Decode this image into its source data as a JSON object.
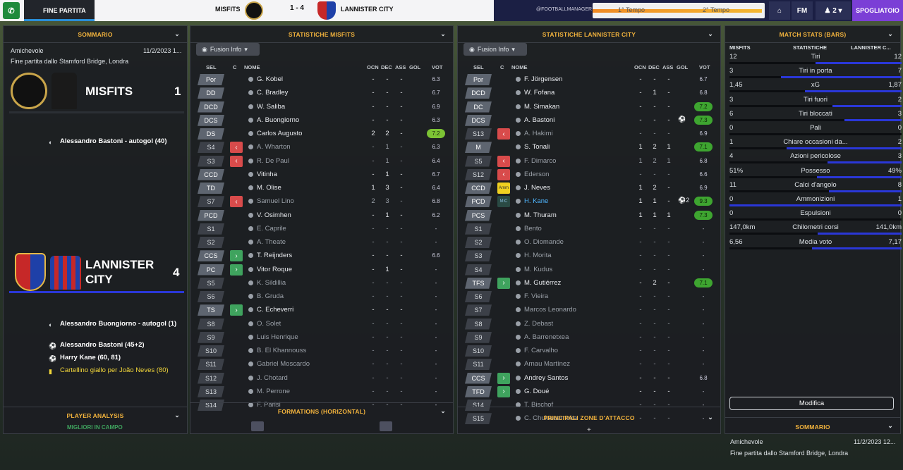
{
  "topbar": {
    "fine_partita": "FINE PARTITA",
    "home_team": "MISFITS",
    "score": "1 - 4",
    "away_team": "LANNISTER CITY",
    "time_first": "1° Tempo",
    "time_second": "2° Tempo",
    "fm_label": "FM",
    "users": "2",
    "spogliatoio": "SPOGLIATOIO",
    "sponsor": "@FOOTBALLMANAGER"
  },
  "summary": {
    "title": "SOMMARIO",
    "competition": "Amichevole",
    "date": "11/2/2023 1...",
    "end_text": "Fine partita dallo Stamford Bridge, Londra",
    "home_name": "MISFITS",
    "home_score": "1",
    "home_events": [
      {
        "icon": "own-goal",
        "text": "Alessandro Bastoni - autogol (40)"
      }
    ],
    "away_name": "LANNISTER CITY",
    "away_score": "4",
    "away_events": [
      {
        "icon": "own-goal",
        "text": "Alessandro Buongiorno - autogol (1)"
      },
      {
        "icon": "goal",
        "text": "Alessandro Bastoni (45+2)"
      },
      {
        "icon": "goal",
        "text": "Harry Kane (60, 81)"
      },
      {
        "icon": "yellow-card",
        "text": "Cartellino giallo per João Neves (80)"
      }
    ],
    "player_analysis": "PLAYER ANALYSIS",
    "migliori": "MIGLIORI IN CAMPO"
  },
  "misfits_stats": {
    "title": "STATISTICHE MISFITS",
    "fusion": "Fusion Info",
    "headers": {
      "sel": "SEL",
      "c": "C",
      "nome": "NOME",
      "ocn": "OCN",
      "dec": "DEC",
      "ass": "ASS",
      "gol": "GOL",
      "vot": "VOT"
    },
    "rows": [
      {
        "pos": "Por",
        "ind": "",
        "name": "G. Kobel",
        "ocn": "-",
        "dec": "-",
        "ass": "-",
        "gol": "",
        "vot": "6.3",
        "vc": "",
        "dim": false
      },
      {
        "pos": "DD",
        "ind": "",
        "name": "C. Bradley",
        "ocn": "-",
        "dec": "-",
        "ass": "-",
        "gol": "",
        "vot": "6.7",
        "vc": "",
        "dim": false
      },
      {
        "pos": "DCD",
        "ind": "",
        "name": "W. Saliba",
        "ocn": "-",
        "dec": "-",
        "ass": "-",
        "gol": "",
        "vot": "6.9",
        "vc": "",
        "dim": false
      },
      {
        "pos": "DCS",
        "ind": "",
        "name": "A. Buongiorno",
        "ocn": "-",
        "dec": "-",
        "ass": "-",
        "gol": "",
        "vot": "6.3",
        "vc": "",
        "dim": false
      },
      {
        "pos": "DS",
        "ind": "",
        "name": "Carlos Augusto",
        "ocn": "2",
        "dec": "2",
        "ass": "-",
        "gol": "",
        "vot": "7.2",
        "vc": "g",
        "dim": false
      },
      {
        "pos": "S4",
        "ind": "out",
        "name": "A. Wharton",
        "ocn": "-",
        "dec": "1",
        "ass": "-",
        "gol": "",
        "vot": "6.3",
        "vc": "",
        "dim": true
      },
      {
        "pos": "S3",
        "ind": "out",
        "name": "R. De Paul",
        "ocn": "-",
        "dec": "1",
        "ass": "-",
        "gol": "",
        "vot": "6.4",
        "vc": "",
        "dim": true
      },
      {
        "pos": "CCD",
        "ind": "",
        "name": "Vitinha",
        "ocn": "-",
        "dec": "1",
        "ass": "-",
        "gol": "",
        "vot": "6.7",
        "vc": "",
        "dim": false
      },
      {
        "pos": "TD",
        "ind": "",
        "name": "M. Olise",
        "ocn": "1",
        "dec": "3",
        "ass": "-",
        "gol": "",
        "vot": "6.4",
        "vc": "",
        "dim": false
      },
      {
        "pos": "S7",
        "ind": "out",
        "name": "Samuel Lino",
        "ocn": "2",
        "dec": "3",
        "ass": "-",
        "gol": "",
        "vot": "6.8",
        "vc": "",
        "dim": true
      },
      {
        "pos": "PCD",
        "ind": "",
        "name": "V. Osimhen",
        "ocn": "-",
        "dec": "1",
        "ass": "-",
        "gol": "",
        "vot": "6.2",
        "vc": "",
        "dim": false
      },
      {
        "pos": "S1",
        "ind": "",
        "name": "E. Caprile",
        "ocn": "-",
        "dec": "-",
        "ass": "-",
        "gol": "",
        "vot": "-",
        "vc": "",
        "dim": true
      },
      {
        "pos": "S2",
        "ind": "",
        "name": "A. Theate",
        "ocn": "-",
        "dec": "-",
        "ass": "-",
        "gol": "",
        "vot": "-",
        "vc": "",
        "dim": true
      },
      {
        "pos": "CCS",
        "ind": "in",
        "name": "T. Reijnders",
        "ocn": "-",
        "dec": "-",
        "ass": "-",
        "gol": "",
        "vot": "6.6",
        "vc": "",
        "dim": false
      },
      {
        "pos": "PC",
        "ind": "in",
        "name": "Vitor Roque",
        "ocn": "-",
        "dec": "1",
        "ass": "-",
        "gol": "",
        "vot": "-",
        "vc": "",
        "dim": false
      },
      {
        "pos": "S5",
        "ind": "",
        "name": "K. Sildillia",
        "ocn": "-",
        "dec": "-",
        "ass": "-",
        "gol": "",
        "vot": "-",
        "vc": "",
        "dim": true
      },
      {
        "pos": "S6",
        "ind": "",
        "name": "B. Gruda",
        "ocn": "-",
        "dec": "-",
        "ass": "-",
        "gol": "",
        "vot": "-",
        "vc": "",
        "dim": true
      },
      {
        "pos": "TS",
        "ind": "in",
        "name": "C. Echeverri",
        "ocn": "-",
        "dec": "-",
        "ass": "-",
        "gol": "",
        "vot": "-",
        "vc": "",
        "dim": false
      },
      {
        "pos": "S8",
        "ind": "",
        "name": "O. Solet",
        "ocn": "-",
        "dec": "-",
        "ass": "-",
        "gol": "",
        "vot": "-",
        "vc": "",
        "dim": true
      },
      {
        "pos": "S9",
        "ind": "",
        "name": "Luis Henrique",
        "ocn": "-",
        "dec": "-",
        "ass": "-",
        "gol": "",
        "vot": "-",
        "vc": "",
        "dim": true
      },
      {
        "pos": "S10",
        "ind": "",
        "name": "B. El Khannouss",
        "ocn": "-",
        "dec": "-",
        "ass": "-",
        "gol": "",
        "vot": "-",
        "vc": "",
        "dim": true
      },
      {
        "pos": "S11",
        "ind": "",
        "name": "Gabriel Moscardo",
        "ocn": "-",
        "dec": "-",
        "ass": "-",
        "gol": "",
        "vot": "-",
        "vc": "",
        "dim": true
      },
      {
        "pos": "S12",
        "ind": "",
        "name": "J. Chotard",
        "ocn": "-",
        "dec": "-",
        "ass": "-",
        "gol": "",
        "vot": "-",
        "vc": "",
        "dim": true
      },
      {
        "pos": "S13",
        "ind": "",
        "name": "M. Perrone",
        "ocn": "-",
        "dec": "-",
        "ass": "-",
        "gol": "",
        "vot": "-",
        "vc": "",
        "dim": true
      },
      {
        "pos": "S14",
        "ind": "",
        "name": "F. Parisi",
        "ocn": "-",
        "dec": "-",
        "ass": "-",
        "gol": "",
        "vot": "-",
        "vc": "",
        "dim": true
      }
    ],
    "formations": "FORMATIONS (HORIZONTAL)"
  },
  "lannister_stats": {
    "title": "STATISTICHE LANNISTER CITY",
    "fusion": "Fusion Info",
    "headers": {
      "sel": "SEL",
      "c": "C",
      "nome": "NOME",
      "ocn": "OCN",
      "dec": "DEC",
      "ass": "ASS",
      "gol": "GOL",
      "vot": "VOT"
    },
    "rows": [
      {
        "pos": "Por",
        "ind": "",
        "name": "F. Jörgensen",
        "ocn": "-",
        "dec": "-",
        "ass": "-",
        "gol": "",
        "vot": "6.7",
        "vc": "",
        "dim": false
      },
      {
        "pos": "DCD",
        "ind": "",
        "name": "W. Fofana",
        "ocn": "-",
        "dec": "1",
        "ass": "-",
        "gol": "",
        "vot": "6.8",
        "vc": "",
        "dim": false
      },
      {
        "pos": "DC",
        "ind": "",
        "name": "M. Simakan",
        "ocn": "-",
        "dec": "-",
        "ass": "-",
        "gol": "",
        "vot": "7.2",
        "vc": "gg",
        "dim": false
      },
      {
        "pos": "DCS",
        "ind": "",
        "name": "A. Bastoni",
        "ocn": "-",
        "dec": "-",
        "ass": "-",
        "gol": "⚽",
        "vot": "7.3",
        "vc": "gg",
        "dim": false
      },
      {
        "pos": "S13",
        "ind": "out",
        "name": "A. Hakimi",
        "ocn": "-",
        "dec": "-",
        "ass": "-",
        "gol": "",
        "vot": "6.9",
        "vc": "",
        "dim": true
      },
      {
        "pos": "M",
        "ind": "",
        "name": "S. Tonali",
        "ocn": "1",
        "dec": "2",
        "ass": "1",
        "gol": "",
        "vot": "7.1",
        "vc": "gg",
        "dim": false
      },
      {
        "pos": "S5",
        "ind": "out",
        "name": "F. Dimarco",
        "ocn": "1",
        "dec": "2",
        "ass": "1",
        "gol": "",
        "vot": "6.8",
        "vc": "",
        "dim": true
      },
      {
        "pos": "S12",
        "ind": "out",
        "name": "Ederson",
        "ocn": "-",
        "dec": "-",
        "ass": "-",
        "gol": "",
        "vot": "6.6",
        "vc": "",
        "dim": true
      },
      {
        "pos": "CCD",
        "ind": "amm",
        "name": "J. Neves",
        "ocn": "1",
        "dec": "2",
        "ass": "-",
        "gol": "",
        "vot": "6.9",
        "vc": "",
        "dim": false
      },
      {
        "pos": "PCD",
        "ind": "mic",
        "name": "H. Kane",
        "ocn": "1",
        "dec": "1",
        "ass": "-",
        "gol": "⚽2",
        "vot": "9.3",
        "vc": "gg",
        "dim": false,
        "hl": true
      },
      {
        "pos": "PCS",
        "ind": "",
        "name": "M. Thuram",
        "ocn": "1",
        "dec": "1",
        "ass": "1",
        "gol": "",
        "vot": "7.3",
        "vc": "gg",
        "dim": false
      },
      {
        "pos": "S1",
        "ind": "",
        "name": "Bento",
        "ocn": "-",
        "dec": "-",
        "ass": "-",
        "gol": "",
        "vot": "-",
        "vc": "",
        "dim": true
      },
      {
        "pos": "S2",
        "ind": "",
        "name": "O. Diomande",
        "ocn": "-",
        "dec": "-",
        "ass": "-",
        "gol": "",
        "vot": "-",
        "vc": "",
        "dim": true
      },
      {
        "pos": "S3",
        "ind": "",
        "name": "H. Morita",
        "ocn": "-",
        "dec": "-",
        "ass": "-",
        "gol": "",
        "vot": "-",
        "vc": "",
        "dim": true
      },
      {
        "pos": "S4",
        "ind": "",
        "name": "M. Kudus",
        "ocn": "-",
        "dec": "-",
        "ass": "-",
        "gol": "",
        "vot": "-",
        "vc": "",
        "dim": true
      },
      {
        "pos": "TFS",
        "ind": "in",
        "name": "M. Gutiérrez",
        "ocn": "-",
        "dec": "2",
        "ass": "-",
        "gol": "",
        "vot": "7.1",
        "vc": "gg",
        "dim": false
      },
      {
        "pos": "S6",
        "ind": "",
        "name": "F. Vieira",
        "ocn": "-",
        "dec": "-",
        "ass": "-",
        "gol": "",
        "vot": "-",
        "vc": "",
        "dim": true
      },
      {
        "pos": "S7",
        "ind": "",
        "name": "Marcos Leonardo",
        "ocn": "-",
        "dec": "-",
        "ass": "-",
        "gol": "",
        "vot": "-",
        "vc": "",
        "dim": true
      },
      {
        "pos": "S8",
        "ind": "",
        "name": "Z. Debast",
        "ocn": "-",
        "dec": "-",
        "ass": "-",
        "gol": "",
        "vot": "-",
        "vc": "",
        "dim": true
      },
      {
        "pos": "S9",
        "ind": "",
        "name": "A. Barrenetxea",
        "ocn": "-",
        "dec": "-",
        "ass": "-",
        "gol": "",
        "vot": "-",
        "vc": "",
        "dim": true
      },
      {
        "pos": "S10",
        "ind": "",
        "name": "F. Carvalho",
        "ocn": "-",
        "dec": "-",
        "ass": "-",
        "gol": "",
        "vot": "-",
        "vc": "",
        "dim": true
      },
      {
        "pos": "S11",
        "ind": "",
        "name": "Arnau Martínez",
        "ocn": "-",
        "dec": "-",
        "ass": "-",
        "gol": "",
        "vot": "-",
        "vc": "",
        "dim": true
      },
      {
        "pos": "CCS",
        "ind": "in",
        "name": "Andrey Santos",
        "ocn": "-",
        "dec": "-",
        "ass": "-",
        "gol": "",
        "vot": "6.8",
        "vc": "",
        "dim": false
      },
      {
        "pos": "TFD",
        "ind": "in",
        "name": "G. Doué",
        "ocn": "-",
        "dec": "-",
        "ass": "-",
        "gol": "",
        "vot": "-",
        "vc": "",
        "dim": false
      },
      {
        "pos": "S14",
        "ind": "",
        "name": "T. Bischof",
        "ocn": "-",
        "dec": "-",
        "ass": "-",
        "gol": "",
        "vot": "-",
        "vc": "",
        "dim": true
      },
      {
        "pos": "S15",
        "ind": "",
        "name": "C. Chukwuemeka",
        "ocn": "-",
        "dec": "-",
        "ass": "-",
        "gol": "",
        "vot": "-",
        "vc": "",
        "dim": true
      }
    ],
    "attack_zones": "PRINCIPALI ZONE D'ATTACCO"
  },
  "match_stats": {
    "title": "MATCH STATS (BARS)",
    "col_home": "MISFITS",
    "col_mid": "STATISTICHE",
    "col_away": "LANNISTER C...",
    "rows": [
      {
        "label": "Tiri",
        "home": "12",
        "away": "12",
        "hv": 12,
        "av": 12
      },
      {
        "label": "Tiri in porta",
        "home": "3",
        "away": "7",
        "hv": 3,
        "av": 7
      },
      {
        "label": "xG",
        "home": "1,45",
        "away": "1,87",
        "hv": 1.45,
        "av": 1.87
      },
      {
        "label": "Tiri fuori",
        "home": "3",
        "away": "2",
        "hv": 3,
        "av": 2
      },
      {
        "label": "Tiri bloccati",
        "home": "6",
        "away": "3",
        "hv": 6,
        "av": 3
      },
      {
        "label": "Pali",
        "home": "0",
        "away": "0",
        "hv": 0,
        "av": 0
      },
      {
        "label": "Chiare occasioni da...",
        "home": "1",
        "away": "2",
        "hv": 1,
        "av": 2
      },
      {
        "label": "Azioni pericolose",
        "home": "4",
        "away": "3",
        "hv": 4,
        "av": 3
      },
      {
        "label": "Possesso",
        "home": "51%",
        "away": "49%",
        "hv": 51,
        "av": 49
      },
      {
        "label": "Calci d'angolo",
        "home": "11",
        "away": "8",
        "hv": 11,
        "av": 8
      },
      {
        "label": "Ammonizioni",
        "home": "0",
        "away": "1",
        "hv": 0,
        "av": 1
      },
      {
        "label": "Espulsioni",
        "home": "0",
        "away": "0",
        "hv": 0,
        "av": 0
      },
      {
        "label": "Chilometri corsi",
        "home": "147,0km",
        "away": "141,0km",
        "hv": 147,
        "av": 141
      },
      {
        "label": "Media voto",
        "home": "6,56",
        "away": "7,17",
        "hv": 6.56,
        "av": 7.17
      }
    ],
    "modify": "Modifica",
    "sub_title": "SOMMARIO",
    "sub_comp": "Amichevole",
    "sub_date": "11/2/2023 12...",
    "sub_text": "Fine partita dallo Stamford Bridge, Londra"
  }
}
